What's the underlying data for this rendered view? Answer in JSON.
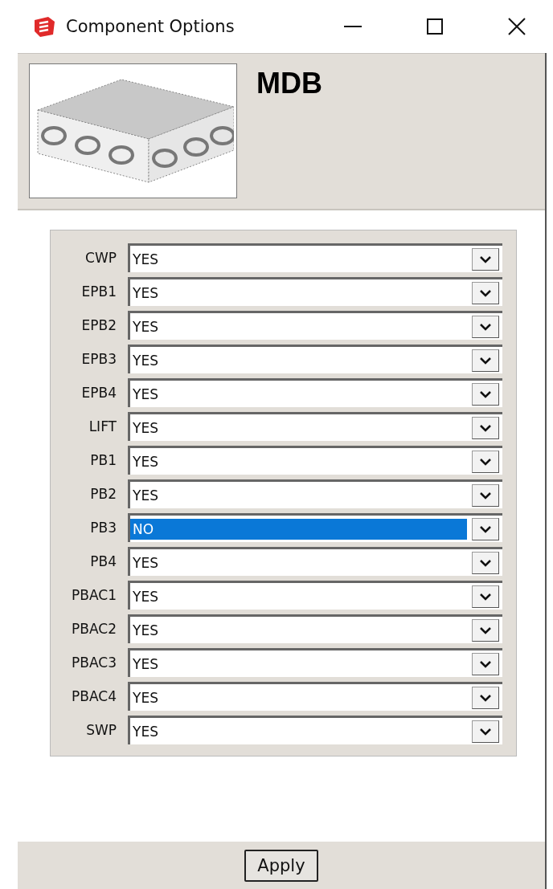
{
  "window": {
    "title": "Component Options"
  },
  "component": {
    "name": "MDB"
  },
  "options": [
    {
      "label": "CWP",
      "value": "YES",
      "selected": false
    },
    {
      "label": "EPB1",
      "value": "YES",
      "selected": false
    },
    {
      "label": "EPB2",
      "value": "YES",
      "selected": false
    },
    {
      "label": "EPB3",
      "value": "YES",
      "selected": false
    },
    {
      "label": "EPB4",
      "value": "YES",
      "selected": false
    },
    {
      "label": "LIFT",
      "value": "YES",
      "selected": false
    },
    {
      "label": "PB1",
      "value": "YES",
      "selected": false
    },
    {
      "label": "PB2",
      "value": "YES",
      "selected": false
    },
    {
      "label": "PB3",
      "value": "NO",
      "selected": true
    },
    {
      "label": "PB4",
      "value": "YES",
      "selected": false
    },
    {
      "label": "PBAC1",
      "value": "YES",
      "selected": false
    },
    {
      "label": "PBAC2",
      "value": "YES",
      "selected": false
    },
    {
      "label": "PBAC3",
      "value": "YES",
      "selected": false
    },
    {
      "label": "PBAC4",
      "value": "YES",
      "selected": false
    },
    {
      "label": "SWP",
      "value": "YES",
      "selected": false
    }
  ],
  "buttons": [
    "Apply"
  ]
}
